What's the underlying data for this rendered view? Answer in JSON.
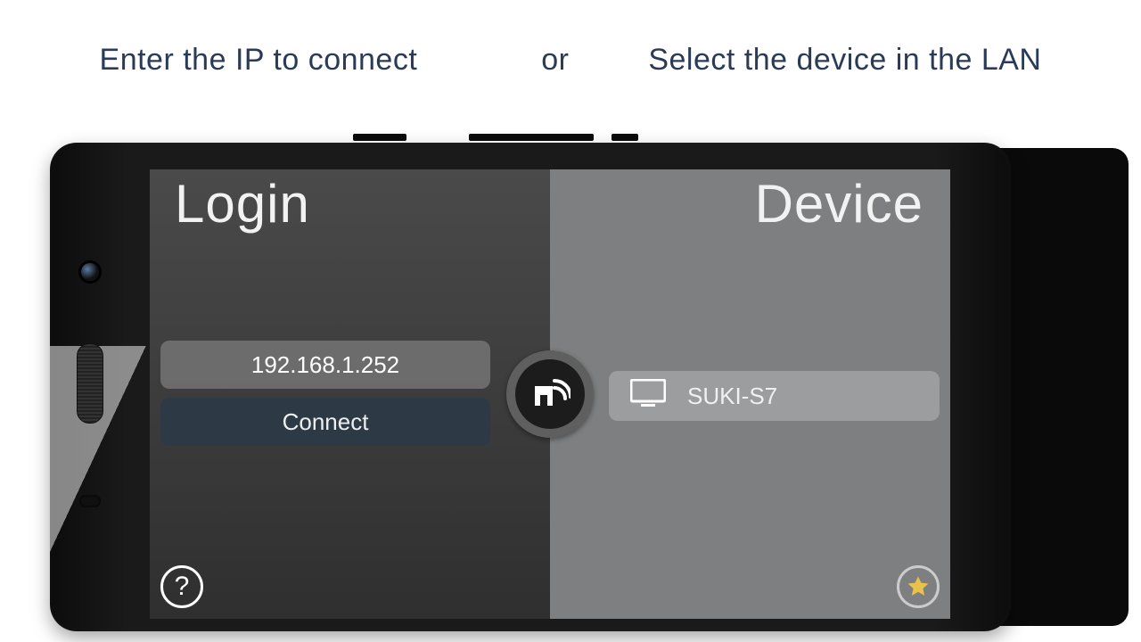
{
  "instructions": {
    "left": "Enter the IP to connect",
    "mid": "or",
    "right": "Select the device in the LAN"
  },
  "login": {
    "title": "Login",
    "ip_value": "192.168.1.252",
    "connect_label": "Connect"
  },
  "device": {
    "title": "Device",
    "items": [
      {
        "name": "SUKI-S7"
      }
    ]
  },
  "icons": {
    "help": "?",
    "center": "cast-icon",
    "favorite": "star-icon",
    "monitor": "monitor-icon"
  }
}
